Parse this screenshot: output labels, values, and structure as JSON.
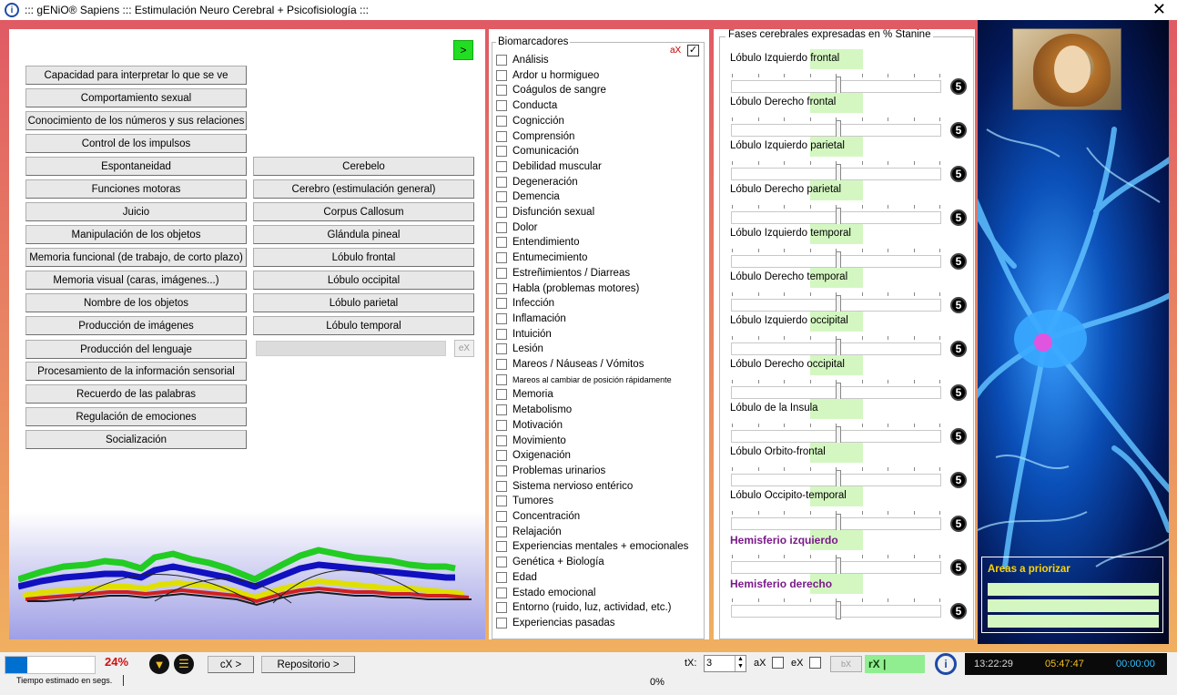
{
  "window": {
    "title": "::: gENiO® Sapiens ::: Estimulación Neuro Cerebral + Psicofisiología :::",
    "app_icon": "genio-logo-icon",
    "close_label": "✕"
  },
  "left": {
    "go_button": ">",
    "col1": [
      "Capacidad para interpretar lo que se ve",
      "Comportamiento sexual",
      "Conocimiento de los números y sus relaciones",
      "Control de los impulsos",
      "Espontaneidad",
      "Funciones motoras",
      "Juicio",
      "Manipulación de los objetos",
      "Memoria funcional (de trabajo, de corto plazo)",
      "Memoria visual (caras, imágenes...)",
      "Nombre de los objetos",
      "Producción de imágenes",
      "Producción del lenguaje",
      "Procesamiento de la información sensorial",
      "Recuerdo de las palabras",
      "Regulación de emociones",
      "Socialización"
    ],
    "col2": [
      "Cerebelo",
      "Cerebro (estimulación general)",
      "Corpus Callosum",
      "Glándula pineal",
      "Lóbulo frontal",
      "Lóbulo occipital",
      "Lóbulo parietal",
      "Lóbulo temporal"
    ],
    "search_value": "",
    "ex_button": "eX"
  },
  "biomarkers": {
    "legend": "Biomarcadores",
    "ax_label": "aX",
    "ax_checked": "✓",
    "items": [
      "Análisis",
      "Ardor u hormigueo",
      "Coágulos de sangre",
      "Conducta",
      "Cognicción",
      "Comprensión",
      "Comunicación",
      "Debilidad muscular",
      "Degeneración",
      "Demencia",
      "Disfunción sexual",
      "Dolor",
      "Entendimiento",
      "Entumecimiento",
      "Estreñimientos / Diarreas",
      "Habla (problemas motores)",
      "Infección",
      "Inflamación",
      "Intuición",
      "Lesión",
      "Mareos / Náuseas / Vómitos",
      "Mareos al cambiar de posición rápidamente",
      "Memoria",
      "Metabolismo",
      "Motivación",
      "Movimiento",
      "Oxigenación",
      "Problemas urinarios",
      "Sistema nervioso entérico",
      "Tumores",
      "Concentración",
      "Relajación",
      "Experiencias mentales + emocionales",
      "Genética + Biología",
      "Edad",
      "Estado emocional",
      "Entorno (ruido, luz, actividad, etc.)",
      "Experiencias pasadas"
    ]
  },
  "phases": {
    "legend": "Fases cerebrales expresadas en % Stanine",
    "items": [
      {
        "label": "Lóbulo Izquierdo frontal",
        "value": "5"
      },
      {
        "label": "Lóbulo Derecho frontal",
        "value": "5"
      },
      {
        "label": "Lóbulo Izquierdo parietal",
        "value": "5"
      },
      {
        "label": "Lóbulo Derecho parietal",
        "value": "5"
      },
      {
        "label": "Lóbulo Izquierdo temporal",
        "value": "5"
      },
      {
        "label": "Lóbulo Derecho temporal",
        "value": "5"
      },
      {
        "label": "Lóbulo Izquierdo occipital",
        "value": "5"
      },
      {
        "label": "Lóbulo Derecho occipital",
        "value": "5"
      },
      {
        "label": "Lóbulo de la Insula",
        "value": "5"
      },
      {
        "label": "Lóbulo Orbito-frontal",
        "value": "5"
      },
      {
        "label": "Lóbulo Occipito-temporal",
        "value": "5"
      },
      {
        "label": "Hemisferio izquierdo",
        "value": "5"
      },
      {
        "label": "Hemisferio derecho",
        "value": "5"
      }
    ]
  },
  "image_panel": {
    "areas_title": "Areas a priorizar"
  },
  "status": {
    "progress_percent": 24,
    "progress_label": "24%",
    "cx_button": "cX >",
    "repo_button": "Repositorio >",
    "hint": "Tiempo estimado en segs.",
    "percent_zero": "0%",
    "tx_label": "tX:",
    "tx_value": "3",
    "ax_label": "aX",
    "ex_label": "eX",
    "bx_button": "bX",
    "rx_label": "rX |",
    "clock_time": "13:22:29",
    "clock_elapsed": "05:47:47",
    "clock_zero": "00:00:00"
  }
}
